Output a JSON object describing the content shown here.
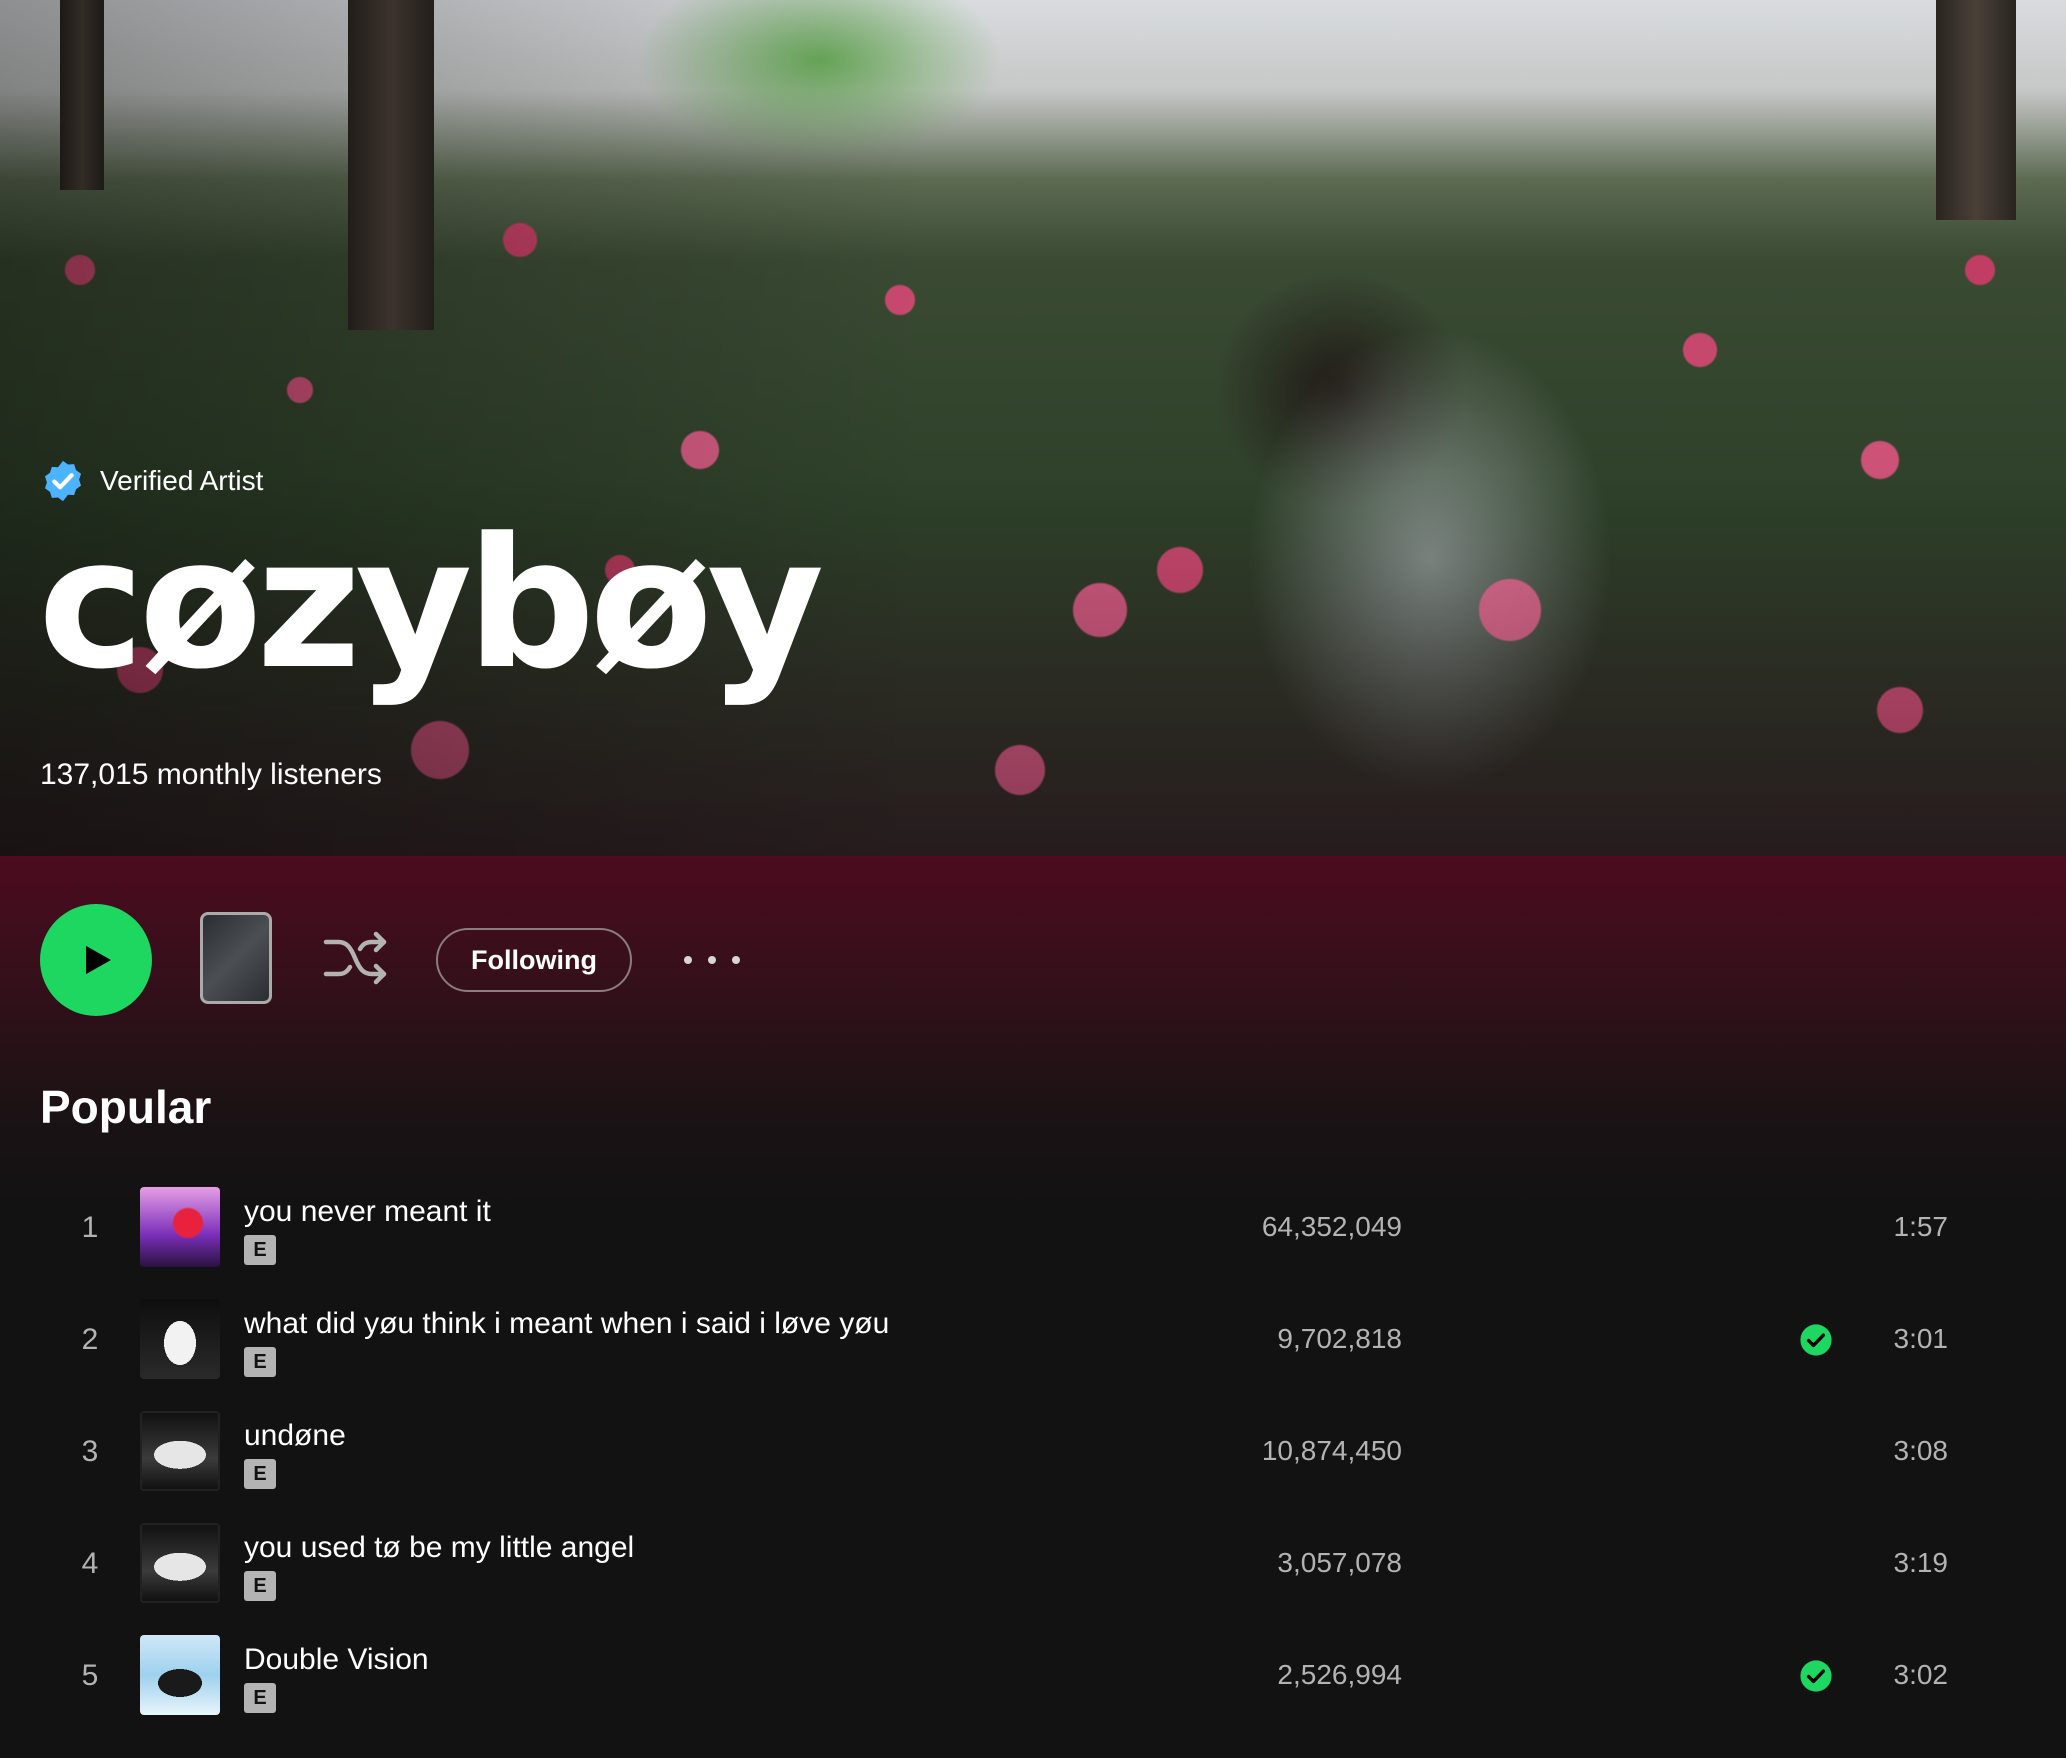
{
  "artist": {
    "verified_label": "Verified Artist",
    "name": "cøzybøy",
    "monthly_listeners": "137,015 monthly listeners"
  },
  "actions": {
    "following_label": "Following",
    "play_icon": "play-icon",
    "shuffle_icon": "shuffle-icon",
    "more_icon": "more-options-icon"
  },
  "popular": {
    "title": "Popular",
    "tracks": [
      {
        "number": "1",
        "title": "you never meant it",
        "explicit": "E",
        "plays": "64,352,049",
        "saved": false,
        "duration": "1:57"
      },
      {
        "number": "2",
        "title": "what did yøu think i meant when i said i løve yøu",
        "explicit": "E",
        "plays": "9,702,818",
        "saved": true,
        "duration": "3:01"
      },
      {
        "number": "3",
        "title": "undøne",
        "explicit": "E",
        "plays": "10,874,450",
        "saved": false,
        "duration": "3:08"
      },
      {
        "number": "4",
        "title": "you used tø be my little angel",
        "explicit": "E",
        "plays": "3,057,078",
        "saved": false,
        "duration": "3:19"
      },
      {
        "number": "5",
        "title": "Double Vision",
        "explicit": "E",
        "plays": "2,526,994",
        "saved": true,
        "duration": "3:02"
      }
    ]
  },
  "colors": {
    "accent": "#1ed760",
    "verified_badge": "#4cb3ff",
    "header_gradient_top": "#4c0b1f",
    "background": "#121212"
  }
}
